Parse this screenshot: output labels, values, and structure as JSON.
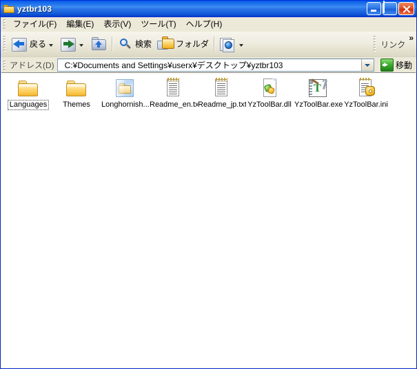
{
  "window": {
    "title": "yztbr103",
    "title_icon": "folder-icon",
    "controls": {
      "minimize": "minimize-button",
      "maximize": "maximize-button",
      "close": "close-button"
    }
  },
  "menubar": {
    "items": [
      {
        "label": "ファイル(F)",
        "name": "menu-file"
      },
      {
        "label": "編集(E)",
        "name": "menu-edit"
      },
      {
        "label": "表示(V)",
        "name": "menu-view"
      },
      {
        "label": "ツール(T)",
        "name": "menu-tools"
      },
      {
        "label": "ヘルプ(H)",
        "name": "menu-help"
      }
    ]
  },
  "toolbar": {
    "back_label": "戻る",
    "search_label": "検索",
    "folders_label": "フォルダ",
    "links_label": "リンク",
    "overflow_chevron": "»"
  },
  "addressbar": {
    "label": "アドレス(D)",
    "path": "C:¥Documents and Settings¥userx¥デスクトップ¥yztbr103",
    "go_label": "移動"
  },
  "files": [
    {
      "name": "Languages",
      "type": "folder",
      "focused": true
    },
    {
      "name": "Themes",
      "type": "folder",
      "focused": false
    },
    {
      "name": "Longhornish...",
      "type": "zipfolder",
      "focused": false
    },
    {
      "name": "Readme_en.txt",
      "type": "txt",
      "focused": false
    },
    {
      "name": "Readme_jp.txt",
      "type": "txt",
      "focused": false
    },
    {
      "name": "YzToolBar.dll",
      "type": "dll",
      "focused": false
    },
    {
      "name": "YzToolBar.exe",
      "type": "exe",
      "focused": false
    },
    {
      "name": "YzToolBar.ini",
      "type": "ini",
      "focused": false
    }
  ],
  "colors": {
    "titlebar_blue": "#0a4ad0",
    "window_border": "#0831d9",
    "chrome_beige": "#ece9d8",
    "folder_yellow": "#fbcb54",
    "go_green": "#3fae34"
  }
}
